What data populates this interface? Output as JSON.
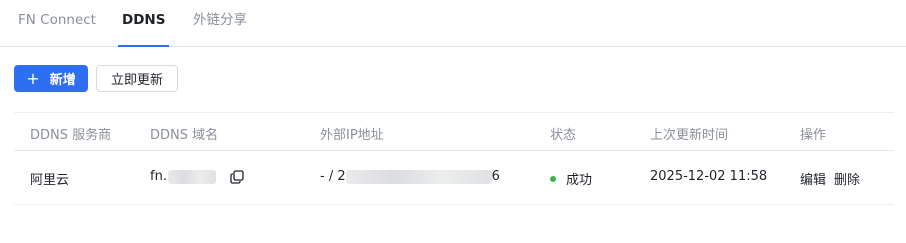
{
  "tabs": [
    {
      "label": "FN Connect"
    },
    {
      "label": "DDNS"
    },
    {
      "label": "外链分享"
    }
  ],
  "toolbar": {
    "add_label": "新增",
    "add_icon": "plus-icon",
    "refresh_label": "立即更新"
  },
  "table": {
    "headers": [
      "DDNS 服务商",
      "DDNS 域名",
      "外部IP地址",
      "状态",
      "上次更新时间",
      "操作"
    ],
    "rows": [
      {
        "provider": "阿里云",
        "domain_prefix": "fn.",
        "ip_prefix": "- / 2",
        "ip_suffix": "6",
        "status": "成功",
        "status_color": "#3bb44a",
        "updated": "2025-12-02 11:58",
        "actions": [
          "编辑",
          "删除"
        ]
      }
    ]
  },
  "colors": {
    "accent": "#2d6ff0",
    "success": "#3bb44a"
  }
}
